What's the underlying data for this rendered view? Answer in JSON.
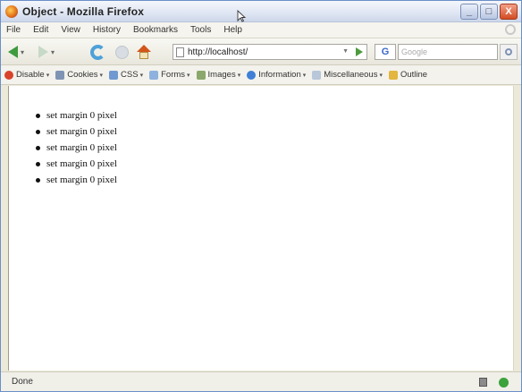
{
  "window": {
    "title": "Object - Mozilla Firefox",
    "buttons": {
      "minimize": "_",
      "maximize": "□",
      "close": "X"
    }
  },
  "menu": [
    "File",
    "Edit",
    "View",
    "History",
    "Bookmarks",
    "Tools",
    "Help"
  ],
  "nav": {
    "url": "http://localhost/",
    "search_engine_letter": "G",
    "search_placeholder": "Google"
  },
  "devbar": {
    "items": [
      {
        "label": "Disable",
        "color": "#d8432b"
      },
      {
        "label": "Cookies",
        "color": "#7e94b5"
      },
      {
        "label": "CSS",
        "color": "#6f9ad1"
      },
      {
        "label": "Forms",
        "color": "#8fb1de"
      },
      {
        "label": "Images",
        "color": "#8aa86b"
      },
      {
        "label": "Information",
        "color": "#3f7fd6"
      },
      {
        "label": "Miscellaneous",
        "color": "#b8c7d9"
      },
      {
        "label": "Outline",
        "color": "#e3b640"
      }
    ]
  },
  "content": {
    "items": [
      "set margin 0 pixel",
      "set margin 0 pixel",
      "set margin 0 pixel",
      "set margin 0 pixel",
      "set margin 0 pixel"
    ]
  },
  "status": {
    "text": "Done"
  }
}
